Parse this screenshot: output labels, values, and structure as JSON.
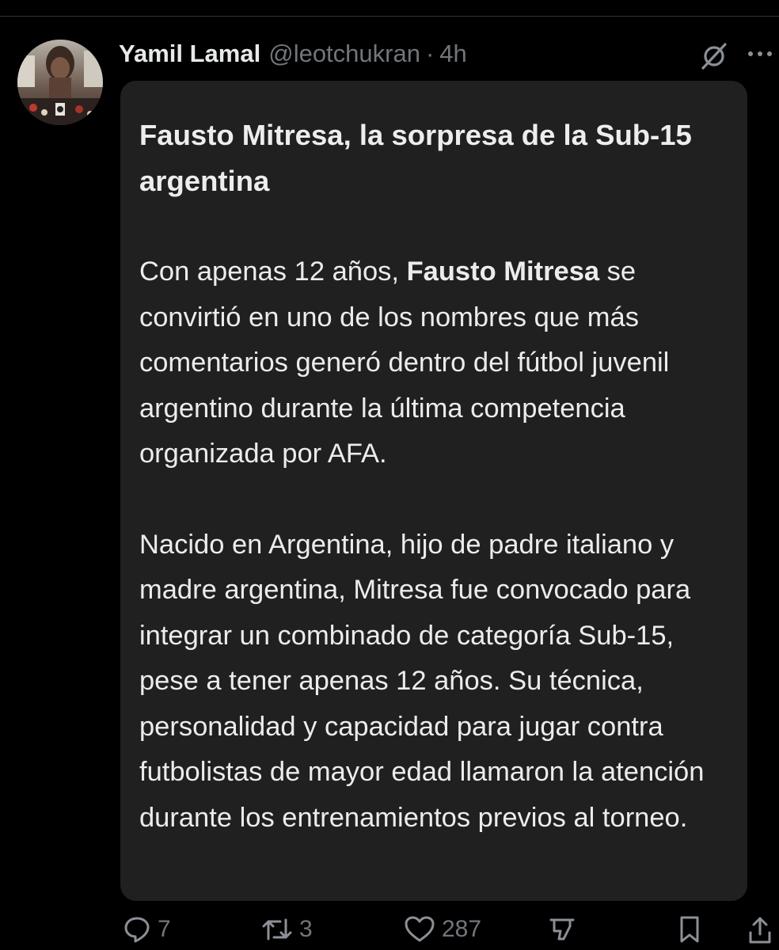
{
  "post": {
    "author_name": "Yamil Lamal",
    "author_handle": "@leotchukran",
    "separator": "·",
    "time": "4h",
    "icons": {
      "avatar": "avatar",
      "grok": "grok-icon",
      "more": "more-icon"
    }
  },
  "card": {
    "title": "Fausto Mitresa, la sorpresa de la Sub-15 argentina",
    "p1_before": "Con apenas 12 años, ",
    "p1_bold": "Fausto Mitresa",
    "p1_after": " se convirtió en uno de los nombres que más comentarios generó dentro del fútbol juvenil argentino durante la última competencia organizada por AFA.",
    "p2": "Nacido en Argentina, hijo de padre italiano y madre argentina, Mitresa fue convocado para integrar un combinado de categoría Sub-15, pese a tener apenas 12 años. Su técnica, personalidad y capacidad para jugar contra futbolistas de mayor edad llamaron la atención durante los entrenamientos previos al torneo."
  },
  "actions": {
    "replies": "7",
    "reposts": "3",
    "likes": "287",
    "icons": [
      "reply-icon",
      "repost-icon",
      "like-icon",
      "views-icon",
      "bookmark-icon",
      "share-icon"
    ]
  },
  "colors": {
    "background": "#000000",
    "card_background": "#202020",
    "primary_text": "#e7e9ea",
    "secondary_text": "#71767b"
  }
}
